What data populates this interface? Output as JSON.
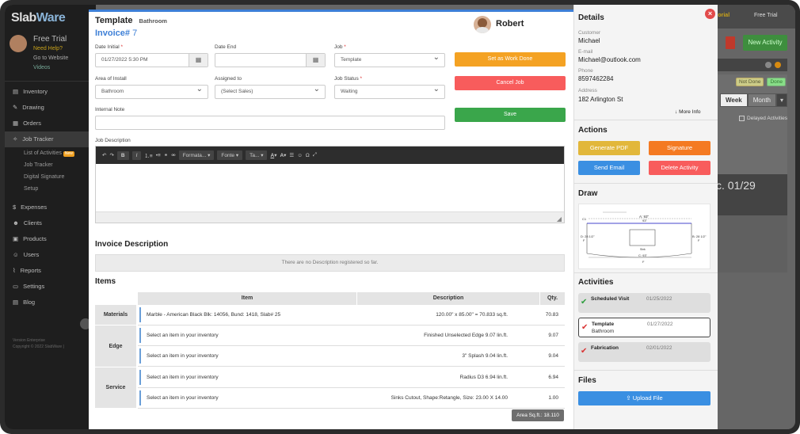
{
  "background": {
    "logo_main": "Slab",
    "logo_accent": "Ware",
    "user_name": "Free Trial",
    "need_help": "Need Help?",
    "go_to_website": "Go to Website",
    "videos": "Videos",
    "nav": [
      {
        "icon": "inventory-icon",
        "label": "Inventory"
      },
      {
        "icon": "drawing-icon",
        "label": "Drawing"
      },
      {
        "icon": "orders-icon",
        "label": "Orders"
      },
      {
        "icon": "job-tracker-icon",
        "label": "Job Tracker"
      }
    ],
    "sub_nav": [
      {
        "label": "List of Activities",
        "badge": "New"
      },
      {
        "label": "Job Tracker"
      },
      {
        "label": "Digital Signature"
      },
      {
        "label": "Setup"
      }
    ],
    "nav2": [
      {
        "icon": "expenses-icon",
        "label": "Expenses"
      },
      {
        "icon": "clients-icon",
        "label": "Clients"
      },
      {
        "icon": "products-icon",
        "label": "Products"
      },
      {
        "icon": "users-icon",
        "label": "Users"
      },
      {
        "icon": "reports-icon",
        "label": "Reports"
      },
      {
        "icon": "settings-icon",
        "label": "Settings"
      },
      {
        "icon": "blog-icon",
        "label": "Blog"
      }
    ],
    "footer_line1": "Version Enterprise",
    "footer_line2": "Copyright © 2022 SlabWare |",
    "tutorial": "Tutorial",
    "top_user": "Free Trial",
    "new_activity": "New Activity",
    "not_done": "Not Done",
    "done": "Done",
    "week": "Week",
    "month": "Month",
    "delayed": "Delayed Activities",
    "date_text": "c. 01/29"
  },
  "header": {
    "title": "Template",
    "subtitle": "Bathroom",
    "invoice_label": "Invoice#",
    "invoice_number": "7",
    "agent_name": "Robert"
  },
  "form": {
    "date_initial_label": "Date Initial",
    "date_initial_value": "01/27/2022 5:30 PM",
    "date_end_label": "Date End",
    "date_end_value": "",
    "job_label": "Job",
    "job_value": "Template",
    "area_label": "Area of Install",
    "area_value": "Bathroom",
    "assigned_label": "Assigned to",
    "assigned_value": "(Select Sales)",
    "status_label": "Job Status",
    "status_value": "Waiting",
    "note_label": "Internal Note",
    "note_value": "",
    "desc_label": "Job Description"
  },
  "buttons": {
    "work_done": "Set as Work Done",
    "cancel_job": "Cancel Job",
    "save": "Save"
  },
  "editor_toolbar": {
    "format": "Formata...",
    "font": "Fonte",
    "size": "Ta..."
  },
  "invoice_description": {
    "title": "Invoice Description",
    "empty_text": "There are no Description registered so far."
  },
  "items": {
    "title": "Items",
    "columns": [
      "Item",
      "Description",
      "Qty."
    ],
    "groups": [
      {
        "name": "Materials",
        "rows": [
          {
            "item": "Marble - American Black Blk: 14056, Bund: 1418, Slab# 25",
            "description": "120.00\" x 85.00\" = 70.833 sq.ft.",
            "qty": "70.83"
          }
        ]
      },
      {
        "name": "Edge",
        "rows": [
          {
            "item": "Select an item in your inventory",
            "description": "Finished Unselected Edge 9.07 lin.ft.",
            "qty": "9.07"
          },
          {
            "item": "Select an item in your inventory",
            "description": "3\" Splash 9.04 lin.ft.",
            "qty": "9.04"
          }
        ]
      },
      {
        "name": "Service",
        "rows": [
          {
            "item": "Select an item in your inventory",
            "description": "Radius D3 6.94 lin.ft.",
            "qty": "6.94"
          },
          {
            "item": "Select an item in your inventory",
            "description": "Sinks Cutout, Shape:Retangle, Size: 23.00 X 14.00",
            "qty": "1.00"
          }
        ]
      }
    ],
    "area_total": "Area Sq.ft.: 18.110"
  },
  "details": {
    "title": "Details",
    "customer_label": "Customer",
    "customer_value": "Michael",
    "email_label": "E-mail",
    "email_value": "Michael@outlook.com",
    "phone_label": "Phone",
    "phone_value": "8597462284",
    "address_label": "Address",
    "address_value": "182 Arlington St",
    "more_info": "More Info"
  },
  "actions": {
    "title": "Actions",
    "generate_pdf": "Generate PDF",
    "signature": "Signature",
    "send_email": "Send Email",
    "delete_activity": "Delete Activity"
  },
  "draw": {
    "title": "Draw",
    "labels": {
      "a": "A: 93\"",
      "a2": "93\"",
      "c": "C: 93\"",
      "d": "D: 28 1/2\"",
      "b": "B: 28 1/2\"",
      "f": "F",
      "c1": "C1",
      "sink": "Sink"
    }
  },
  "activities": {
    "title": "Activities",
    "list": [
      {
        "title": "Scheduled Visit",
        "subtitle": "",
        "date": "01/25/2022",
        "color": "#2e9e3e"
      },
      {
        "title": "Template",
        "subtitle": "Bathroom",
        "date": "01/27/2022",
        "color": "#d93333"
      },
      {
        "title": "Fabrication",
        "subtitle": "",
        "date": "02/01/2022",
        "color": "#d93333"
      }
    ]
  },
  "files": {
    "title": "Files",
    "upload": "Upload File"
  },
  "colors": {
    "accent": "#3d7fd6",
    "orange": "#f4a223",
    "red": "#f85c5c",
    "green": "#3aa64b",
    "yellow": "#e2b73a",
    "blue": "#3a8fe2"
  }
}
